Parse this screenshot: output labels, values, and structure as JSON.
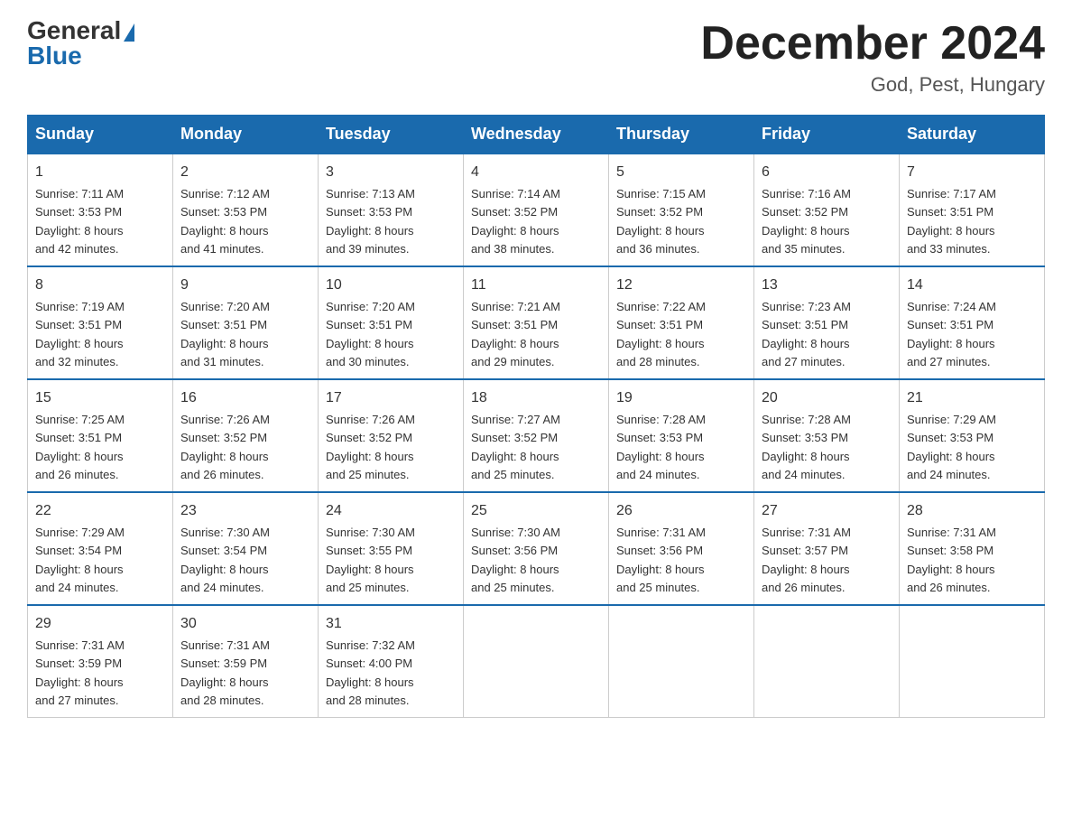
{
  "header": {
    "logo_general": "General",
    "logo_blue": "Blue",
    "month_title": "December 2024",
    "location": "God, Pest, Hungary"
  },
  "days_of_week": [
    "Sunday",
    "Monday",
    "Tuesday",
    "Wednesday",
    "Thursday",
    "Friday",
    "Saturday"
  ],
  "weeks": [
    [
      {
        "num": "1",
        "sunrise": "7:11 AM",
        "sunset": "3:53 PM",
        "daylight": "8 hours and 42 minutes."
      },
      {
        "num": "2",
        "sunrise": "7:12 AM",
        "sunset": "3:53 PM",
        "daylight": "8 hours and 41 minutes."
      },
      {
        "num": "3",
        "sunrise": "7:13 AM",
        "sunset": "3:53 PM",
        "daylight": "8 hours and 39 minutes."
      },
      {
        "num": "4",
        "sunrise": "7:14 AM",
        "sunset": "3:52 PM",
        "daylight": "8 hours and 38 minutes."
      },
      {
        "num": "5",
        "sunrise": "7:15 AM",
        "sunset": "3:52 PM",
        "daylight": "8 hours and 36 minutes."
      },
      {
        "num": "6",
        "sunrise": "7:16 AM",
        "sunset": "3:52 PM",
        "daylight": "8 hours and 35 minutes."
      },
      {
        "num": "7",
        "sunrise": "7:17 AM",
        "sunset": "3:51 PM",
        "daylight": "8 hours and 33 minutes."
      }
    ],
    [
      {
        "num": "8",
        "sunrise": "7:19 AM",
        "sunset": "3:51 PM",
        "daylight": "8 hours and 32 minutes."
      },
      {
        "num": "9",
        "sunrise": "7:20 AM",
        "sunset": "3:51 PM",
        "daylight": "8 hours and 31 minutes."
      },
      {
        "num": "10",
        "sunrise": "7:20 AM",
        "sunset": "3:51 PM",
        "daylight": "8 hours and 30 minutes."
      },
      {
        "num": "11",
        "sunrise": "7:21 AM",
        "sunset": "3:51 PM",
        "daylight": "8 hours and 29 minutes."
      },
      {
        "num": "12",
        "sunrise": "7:22 AM",
        "sunset": "3:51 PM",
        "daylight": "8 hours and 28 minutes."
      },
      {
        "num": "13",
        "sunrise": "7:23 AM",
        "sunset": "3:51 PM",
        "daylight": "8 hours and 27 minutes."
      },
      {
        "num": "14",
        "sunrise": "7:24 AM",
        "sunset": "3:51 PM",
        "daylight": "8 hours and 27 minutes."
      }
    ],
    [
      {
        "num": "15",
        "sunrise": "7:25 AM",
        "sunset": "3:51 PM",
        "daylight": "8 hours and 26 minutes."
      },
      {
        "num": "16",
        "sunrise": "7:26 AM",
        "sunset": "3:52 PM",
        "daylight": "8 hours and 26 minutes."
      },
      {
        "num": "17",
        "sunrise": "7:26 AM",
        "sunset": "3:52 PM",
        "daylight": "8 hours and 25 minutes."
      },
      {
        "num": "18",
        "sunrise": "7:27 AM",
        "sunset": "3:52 PM",
        "daylight": "8 hours and 25 minutes."
      },
      {
        "num": "19",
        "sunrise": "7:28 AM",
        "sunset": "3:53 PM",
        "daylight": "8 hours and 24 minutes."
      },
      {
        "num": "20",
        "sunrise": "7:28 AM",
        "sunset": "3:53 PM",
        "daylight": "8 hours and 24 minutes."
      },
      {
        "num": "21",
        "sunrise": "7:29 AM",
        "sunset": "3:53 PM",
        "daylight": "8 hours and 24 minutes."
      }
    ],
    [
      {
        "num": "22",
        "sunrise": "7:29 AM",
        "sunset": "3:54 PM",
        "daylight": "8 hours and 24 minutes."
      },
      {
        "num": "23",
        "sunrise": "7:30 AM",
        "sunset": "3:54 PM",
        "daylight": "8 hours and 24 minutes."
      },
      {
        "num": "24",
        "sunrise": "7:30 AM",
        "sunset": "3:55 PM",
        "daylight": "8 hours and 25 minutes."
      },
      {
        "num": "25",
        "sunrise": "7:30 AM",
        "sunset": "3:56 PM",
        "daylight": "8 hours and 25 minutes."
      },
      {
        "num": "26",
        "sunrise": "7:31 AM",
        "sunset": "3:56 PM",
        "daylight": "8 hours and 25 minutes."
      },
      {
        "num": "27",
        "sunrise": "7:31 AM",
        "sunset": "3:57 PM",
        "daylight": "8 hours and 26 minutes."
      },
      {
        "num": "28",
        "sunrise": "7:31 AM",
        "sunset": "3:58 PM",
        "daylight": "8 hours and 26 minutes."
      }
    ],
    [
      {
        "num": "29",
        "sunrise": "7:31 AM",
        "sunset": "3:59 PM",
        "daylight": "8 hours and 27 minutes."
      },
      {
        "num": "30",
        "sunrise": "7:31 AM",
        "sunset": "3:59 PM",
        "daylight": "8 hours and 28 minutes."
      },
      {
        "num": "31",
        "sunrise": "7:32 AM",
        "sunset": "4:00 PM",
        "daylight": "8 hours and 28 minutes."
      },
      null,
      null,
      null,
      null
    ]
  ],
  "labels": {
    "sunrise": "Sunrise:",
    "sunset": "Sunset:",
    "daylight": "Daylight:"
  }
}
